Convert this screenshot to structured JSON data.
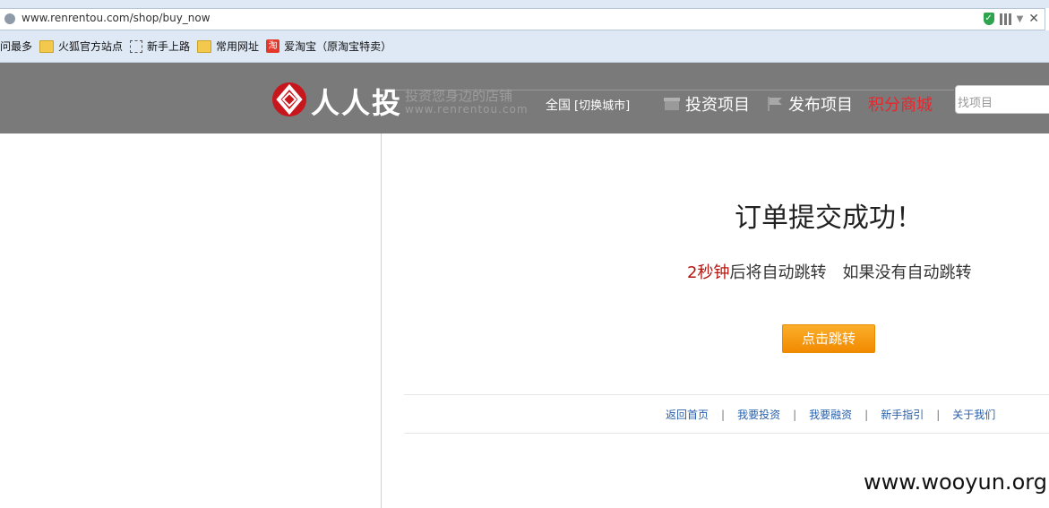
{
  "browser": {
    "url": "www.renrentou.com/shop/buy_now",
    "bookmarks": [
      {
        "label": "问最多",
        "icon": "none"
      },
      {
        "label": "火狐官方站点",
        "icon": "folder-icon"
      },
      {
        "label": "新手上路",
        "icon": "dotted-page-icon"
      },
      {
        "label": "常用网址",
        "icon": "folder-icon"
      },
      {
        "label": "爱淘宝（原淘宝特卖）",
        "icon": "taobao-icon"
      }
    ]
  },
  "header": {
    "logo_text": "人人投",
    "slogan": "投资您身边的店铺",
    "slogan_url": "www.renrentou.com",
    "region": "全国",
    "region_switch": "[切换城市]",
    "nav": {
      "invest": "投资项目",
      "publish": "发布项目",
      "points_mall": "积分商城"
    },
    "search_placeholder": "找项目",
    "accent_color": "#e8262d"
  },
  "main": {
    "title": "订单提交成功！",
    "countdown_seconds": "2秒钟",
    "countdown_rest": "后将自动跳转",
    "fallback_text": "如果没有自动跳转",
    "jump_button": "点击跳转"
  },
  "footer": {
    "links": [
      "返回首页",
      "我要投资",
      "我要融资",
      "新手指引",
      "关于我们"
    ],
    "separator": "|"
  },
  "watermark": "www.wooyun.org"
}
